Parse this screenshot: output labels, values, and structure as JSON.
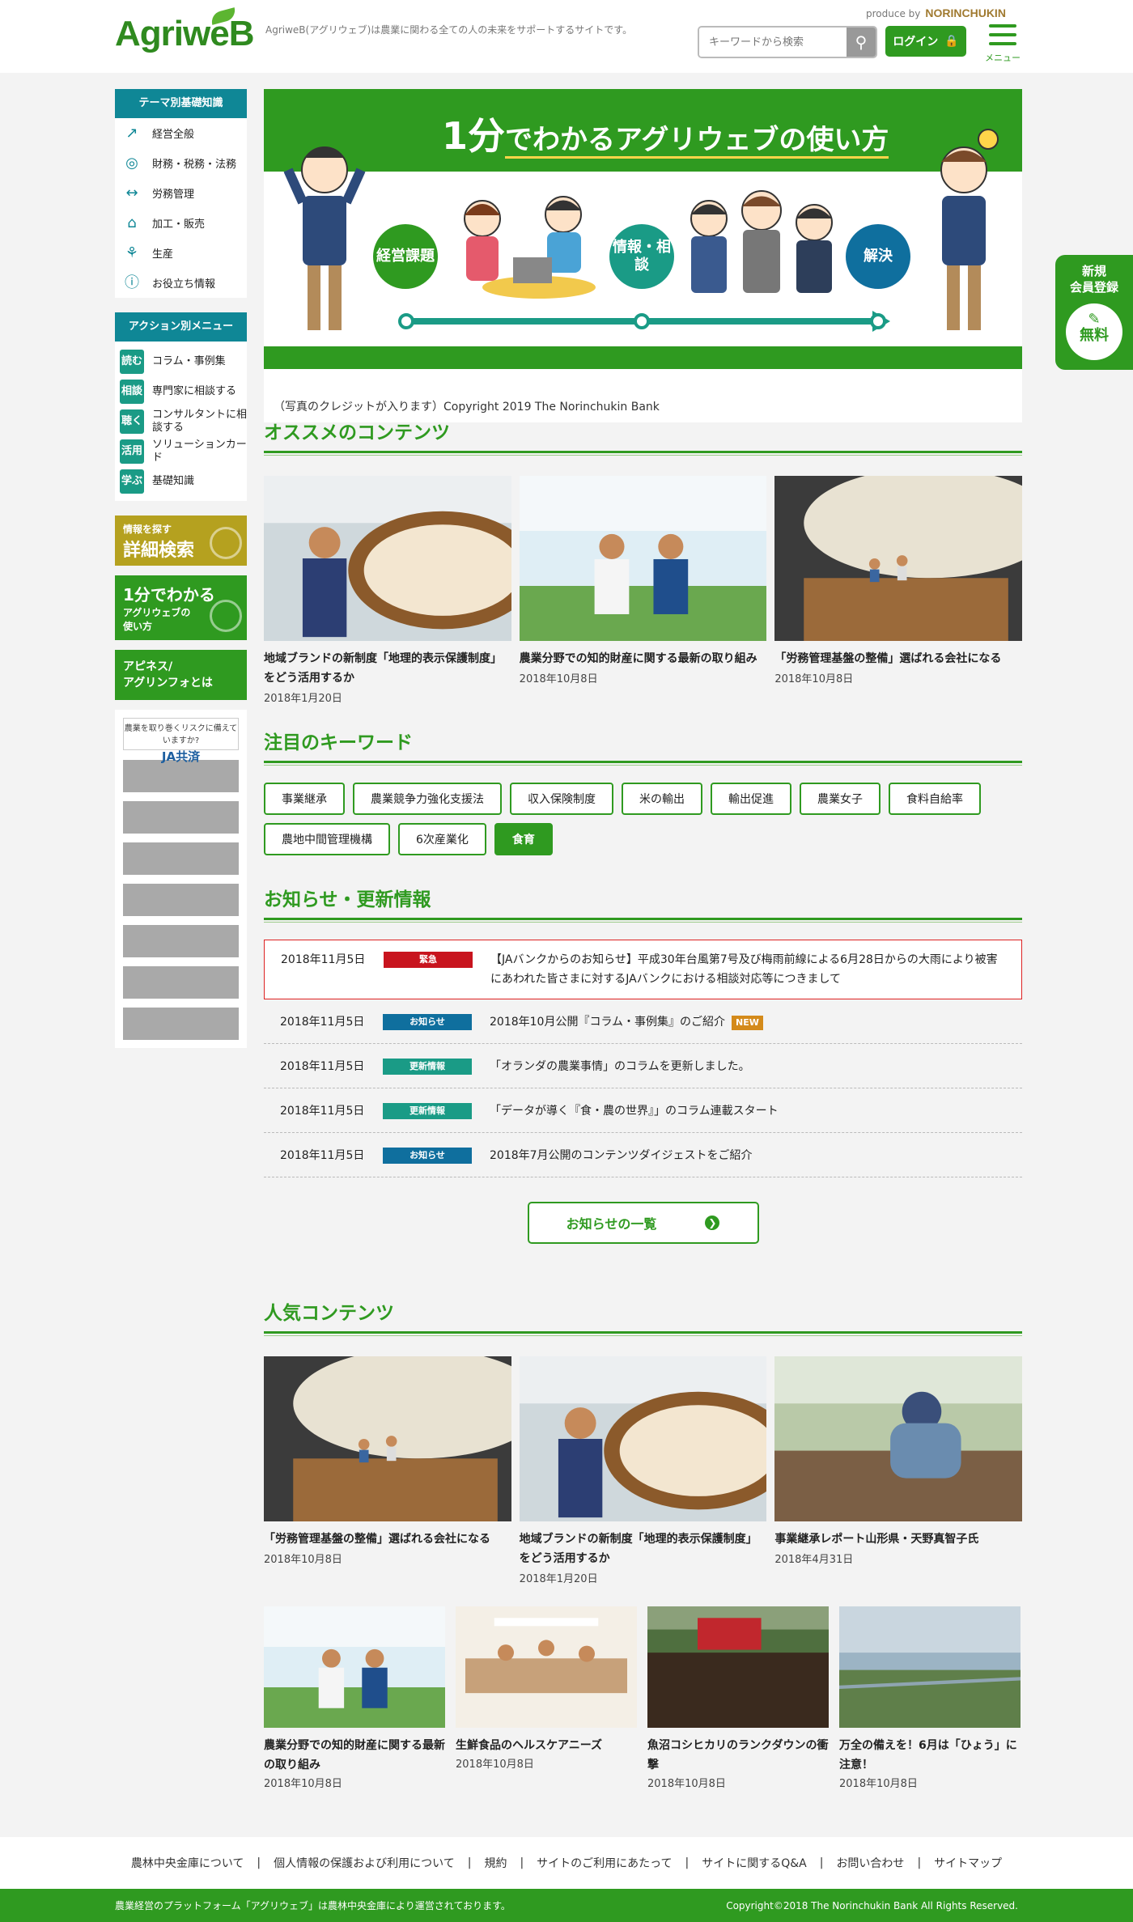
{
  "header": {
    "logo": "AgriweB",
    "tagline": "AgriweB(アグリウェブ)は農業に関わる全ての人の未来をサポートするサイトです。",
    "produce_by": "produce by",
    "produce_brand": "NORINCHUKIN",
    "search_placeholder": "キーワードから検索",
    "login_label": "ログイン",
    "menu_label": "メニュー"
  },
  "register": {
    "line1": "新規",
    "line2": "会員登録",
    "free": "無料"
  },
  "sidebar": {
    "theme_title": "テーマ別基礎知識",
    "theme_items": [
      {
        "label": "経営全般",
        "icon": "chart-icon"
      },
      {
        "label": "財務・税務・法務",
        "icon": "money-bag-icon"
      },
      {
        "label": "労務管理",
        "icon": "handshake-icon"
      },
      {
        "label": "加工・販売",
        "icon": "cart-icon"
      },
      {
        "label": "生産",
        "icon": "sprout-icon"
      },
      {
        "label": "お役立ち情報",
        "icon": "info-icon"
      }
    ],
    "action_title": "アクション別メニュー",
    "action_items": [
      {
        "tag": "読む",
        "label": "コラム・事例集"
      },
      {
        "tag": "相談",
        "label": "専門家に相談する"
      },
      {
        "tag": "聴く",
        "label": "コンサルタントに相談する"
      },
      {
        "tag": "活用",
        "label": "ソリューションカード"
      },
      {
        "tag": "学ぶ",
        "label": "基礎知識"
      }
    ],
    "promo_search_small": "情報を探す",
    "promo_search_big": "詳細検索",
    "promo_guide_1": "1分でわかる",
    "promo_guide_2": "アグリウェブの",
    "promo_guide_3": "使い方",
    "promo_about_1": "アピネス/",
    "promo_about_2": "アグリンフォとは",
    "ja_banner_top": "農業を取り巻くリスクに備えていますか?",
    "ja_banner_name": "JA共済"
  },
  "hero": {
    "title_num": "1分",
    "title_rest": "でわかるアグリウェブの使い方",
    "step1": "経営課題",
    "step2": "情報・相談",
    "step3": "解決",
    "credit": "（写真のクレジットが入ります）Copyright 2019 The Norinchukin Bank"
  },
  "osusume": {
    "title": "オススメのコンテンツ",
    "cards": [
      {
        "title": "地域ブランドの新制度「地理的表示保護制度」をどう活用するか",
        "date": "2018年1月20日"
      },
      {
        "title": "農業分野での知的財産に関する最新の取り組み",
        "date": "2018年10月8日"
      },
      {
        "title": "「労務管理基盤の整備」選ばれる会社になる",
        "date": "2018年10月8日"
      }
    ]
  },
  "keywords": {
    "title": "注目のキーワード",
    "items": [
      "事業継承",
      "農業競争力強化支援法",
      "収入保険制度",
      "米の輸出",
      "輸出促進",
      "農業女子",
      "食料自給率",
      "農地中間管理機構",
      "6次産業化",
      "食育"
    ]
  },
  "news": {
    "title": "お知らせ・更新情報",
    "rows": [
      {
        "date": "2018年11月5日",
        "label": "緊急",
        "color": "#c8141e",
        "text": "【JAバンクからのお知らせ】平成30年台風第7号及び梅雨前線による6月28日からの大雨により被害にあわれた皆さまに対するJAバンクにおける相談対応等につきまして",
        "new": ""
      },
      {
        "date": "2018年11月5日",
        "label": "お知らせ",
        "color": "#0f6f9e",
        "text": "2018年10月公開『コラム・事例集』のご紹介",
        "new": "NEW"
      },
      {
        "date": "2018年11月5日",
        "label": "更新情報",
        "color": "#1a9b86",
        "text": "「オランダの農業事情」のコラムを更新しました。",
        "new": ""
      },
      {
        "date": "2018年11月5日",
        "label": "更新情報",
        "color": "#1a9b86",
        "text": "「データが導く『食・農の世界』」のコラム連載スタート",
        "new": ""
      },
      {
        "date": "2018年11月5日",
        "label": "お知らせ",
        "color": "#0f6f9e",
        "text": "2018年7月公開のコンテンツダイジェストをご紹介",
        "new": ""
      }
    ],
    "more_label": "お知らせの一覧"
  },
  "popular": {
    "title": "人気コンテンツ",
    "cards3": [
      {
        "title": "「労務管理基盤の整備」選ばれる会社になる",
        "date": "2018年10月8日"
      },
      {
        "title": "地域ブランドの新制度「地理的表示保護制度」をどう活用するか",
        "date": "2018年1月20日"
      },
      {
        "title": "事業継承レポート山形県・天野真智子氏",
        "date": "2018年4月31日"
      }
    ],
    "cards4": [
      {
        "title": "農業分野での知的財産に関する最新の取り組み",
        "date": "2018年10月8日"
      },
      {
        "title": "生鮮食品のヘルスケアニーズ",
        "date": "2018年10月8日"
      },
      {
        "title": "魚沼コシヒカリのランクダウンの衝撃",
        "date": "2018年10月8日"
      },
      {
        "title": "万全の備えを！6月は「ひょう」に注意！",
        "date": "2018年10月8日"
      }
    ]
  },
  "footer": {
    "links": [
      "農林中央金庫について",
      "個人情報の保護および利用について",
      "規約",
      "サイトのご利用にあたって",
      "サイトに関するQ&A",
      "お問い合わせ",
      "サイトマップ"
    ],
    "left": "農業経営のプラットフォーム「アグリウェブ」は農林中央金庫により運営されております。",
    "right": "Copyright©2018 The Norinchukin Bank All Rights Reserved."
  },
  "colors": {
    "brand_green": "#2f9a20",
    "teal": "#0f8796",
    "urgent_red": "#c8141e"
  }
}
